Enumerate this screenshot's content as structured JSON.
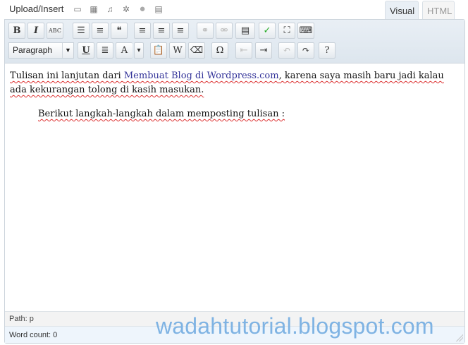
{
  "upload_label": "Upload/Insert",
  "media_icons": [
    "add-image-icon",
    "add-video-icon",
    "add-audio-icon",
    "add-media-icon",
    "add-poll-icon",
    "add-form-icon"
  ],
  "tabs": {
    "visual": "Visual",
    "html": "HTML"
  },
  "format_select": "Paragraph",
  "toolbar_row1": [
    {
      "name": "bold",
      "glyph": "B"
    },
    {
      "name": "italic",
      "glyph": "I"
    },
    {
      "name": "strikethrough",
      "glyph": "ABC"
    },
    {
      "name": "bullet-list",
      "glyph": "☰"
    },
    {
      "name": "numbered-list",
      "glyph": "≡"
    },
    {
      "name": "blockquote",
      "glyph": "❝"
    },
    {
      "name": "align-left",
      "glyph": "≡"
    },
    {
      "name": "align-center",
      "glyph": "≡"
    },
    {
      "name": "align-right",
      "glyph": "≡"
    },
    {
      "name": "insert-link",
      "glyph": "⚭",
      "dim": true
    },
    {
      "name": "unlink",
      "glyph": "⚮",
      "dim": true
    },
    {
      "name": "insert-more",
      "glyph": "▤"
    },
    {
      "name": "spellcheck",
      "glyph": "✓"
    },
    {
      "name": "fullscreen",
      "glyph": "⛶"
    },
    {
      "name": "kitchen-sink",
      "glyph": "⌨"
    }
  ],
  "toolbar_row2": [
    {
      "name": "underline",
      "glyph": "U"
    },
    {
      "name": "justify",
      "glyph": "≣"
    },
    {
      "name": "text-color",
      "glyph": "A"
    },
    {
      "name": "text-color-dropdown",
      "glyph": "▾"
    },
    {
      "name": "paste-text",
      "glyph": "📋"
    },
    {
      "name": "paste-word",
      "glyph": "W"
    },
    {
      "name": "clear-formatting",
      "glyph": "⌫"
    },
    {
      "name": "special-char",
      "glyph": "Ω"
    },
    {
      "name": "outdent",
      "glyph": "⇤",
      "dim": true
    },
    {
      "name": "indent",
      "glyph": "⇥"
    },
    {
      "name": "undo",
      "glyph": "↶",
      "dim": true
    },
    {
      "name": "redo",
      "glyph": "↷"
    },
    {
      "name": "help",
      "glyph": "?"
    }
  ],
  "content": {
    "p1_a": "Tulisan ini lanjutan dari ",
    "p1_link": "Membuat Blog di Wordpress.com",
    "p1_b": ", karena saya masih baru jadi kalau ada kekurangan tolong di kasih masukan.",
    "p2": "Berikut langkah-langkah dalam memposting tulisan :"
  },
  "path": "Path: p",
  "word_count": "Word count: 0",
  "watermark": "wadahtutorial.blogspot.com"
}
